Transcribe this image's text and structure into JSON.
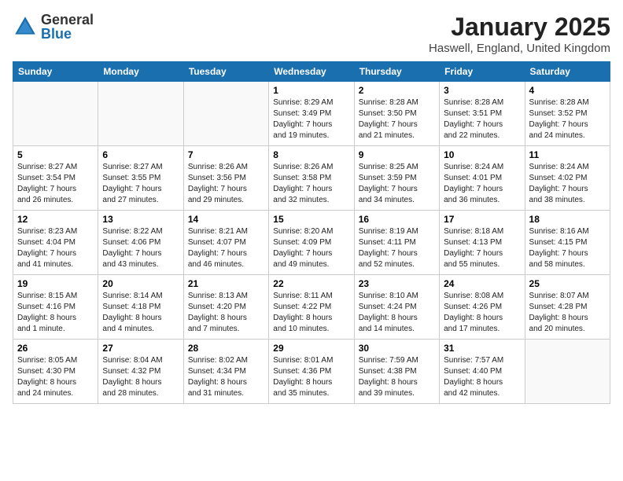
{
  "header": {
    "logo_general": "General",
    "logo_blue": "Blue",
    "month_title": "January 2025",
    "location": "Haswell, England, United Kingdom"
  },
  "weekdays": [
    "Sunday",
    "Monday",
    "Tuesday",
    "Wednesday",
    "Thursday",
    "Friday",
    "Saturday"
  ],
  "weeks": [
    [
      {
        "num": "",
        "info": ""
      },
      {
        "num": "",
        "info": ""
      },
      {
        "num": "",
        "info": ""
      },
      {
        "num": "1",
        "info": "Sunrise: 8:29 AM\nSunset: 3:49 PM\nDaylight: 7 hours\nand 19 minutes."
      },
      {
        "num": "2",
        "info": "Sunrise: 8:28 AM\nSunset: 3:50 PM\nDaylight: 7 hours\nand 21 minutes."
      },
      {
        "num": "3",
        "info": "Sunrise: 8:28 AM\nSunset: 3:51 PM\nDaylight: 7 hours\nand 22 minutes."
      },
      {
        "num": "4",
        "info": "Sunrise: 8:28 AM\nSunset: 3:52 PM\nDaylight: 7 hours\nand 24 minutes."
      }
    ],
    [
      {
        "num": "5",
        "info": "Sunrise: 8:27 AM\nSunset: 3:54 PM\nDaylight: 7 hours\nand 26 minutes."
      },
      {
        "num": "6",
        "info": "Sunrise: 8:27 AM\nSunset: 3:55 PM\nDaylight: 7 hours\nand 27 minutes."
      },
      {
        "num": "7",
        "info": "Sunrise: 8:26 AM\nSunset: 3:56 PM\nDaylight: 7 hours\nand 29 minutes."
      },
      {
        "num": "8",
        "info": "Sunrise: 8:26 AM\nSunset: 3:58 PM\nDaylight: 7 hours\nand 32 minutes."
      },
      {
        "num": "9",
        "info": "Sunrise: 8:25 AM\nSunset: 3:59 PM\nDaylight: 7 hours\nand 34 minutes."
      },
      {
        "num": "10",
        "info": "Sunrise: 8:24 AM\nSunset: 4:01 PM\nDaylight: 7 hours\nand 36 minutes."
      },
      {
        "num": "11",
        "info": "Sunrise: 8:24 AM\nSunset: 4:02 PM\nDaylight: 7 hours\nand 38 minutes."
      }
    ],
    [
      {
        "num": "12",
        "info": "Sunrise: 8:23 AM\nSunset: 4:04 PM\nDaylight: 7 hours\nand 41 minutes."
      },
      {
        "num": "13",
        "info": "Sunrise: 8:22 AM\nSunset: 4:06 PM\nDaylight: 7 hours\nand 43 minutes."
      },
      {
        "num": "14",
        "info": "Sunrise: 8:21 AM\nSunset: 4:07 PM\nDaylight: 7 hours\nand 46 minutes."
      },
      {
        "num": "15",
        "info": "Sunrise: 8:20 AM\nSunset: 4:09 PM\nDaylight: 7 hours\nand 49 minutes."
      },
      {
        "num": "16",
        "info": "Sunrise: 8:19 AM\nSunset: 4:11 PM\nDaylight: 7 hours\nand 52 minutes."
      },
      {
        "num": "17",
        "info": "Sunrise: 8:18 AM\nSunset: 4:13 PM\nDaylight: 7 hours\nand 55 minutes."
      },
      {
        "num": "18",
        "info": "Sunrise: 8:16 AM\nSunset: 4:15 PM\nDaylight: 7 hours\nand 58 minutes."
      }
    ],
    [
      {
        "num": "19",
        "info": "Sunrise: 8:15 AM\nSunset: 4:16 PM\nDaylight: 8 hours\nand 1 minute."
      },
      {
        "num": "20",
        "info": "Sunrise: 8:14 AM\nSunset: 4:18 PM\nDaylight: 8 hours\nand 4 minutes."
      },
      {
        "num": "21",
        "info": "Sunrise: 8:13 AM\nSunset: 4:20 PM\nDaylight: 8 hours\nand 7 minutes."
      },
      {
        "num": "22",
        "info": "Sunrise: 8:11 AM\nSunset: 4:22 PM\nDaylight: 8 hours\nand 10 minutes."
      },
      {
        "num": "23",
        "info": "Sunrise: 8:10 AM\nSunset: 4:24 PM\nDaylight: 8 hours\nand 14 minutes."
      },
      {
        "num": "24",
        "info": "Sunrise: 8:08 AM\nSunset: 4:26 PM\nDaylight: 8 hours\nand 17 minutes."
      },
      {
        "num": "25",
        "info": "Sunrise: 8:07 AM\nSunset: 4:28 PM\nDaylight: 8 hours\nand 20 minutes."
      }
    ],
    [
      {
        "num": "26",
        "info": "Sunrise: 8:05 AM\nSunset: 4:30 PM\nDaylight: 8 hours\nand 24 minutes."
      },
      {
        "num": "27",
        "info": "Sunrise: 8:04 AM\nSunset: 4:32 PM\nDaylight: 8 hours\nand 28 minutes."
      },
      {
        "num": "28",
        "info": "Sunrise: 8:02 AM\nSunset: 4:34 PM\nDaylight: 8 hours\nand 31 minutes."
      },
      {
        "num": "29",
        "info": "Sunrise: 8:01 AM\nSunset: 4:36 PM\nDaylight: 8 hours\nand 35 minutes."
      },
      {
        "num": "30",
        "info": "Sunrise: 7:59 AM\nSunset: 4:38 PM\nDaylight: 8 hours\nand 39 minutes."
      },
      {
        "num": "31",
        "info": "Sunrise: 7:57 AM\nSunset: 4:40 PM\nDaylight: 8 hours\nand 42 minutes."
      },
      {
        "num": "",
        "info": ""
      }
    ]
  ]
}
